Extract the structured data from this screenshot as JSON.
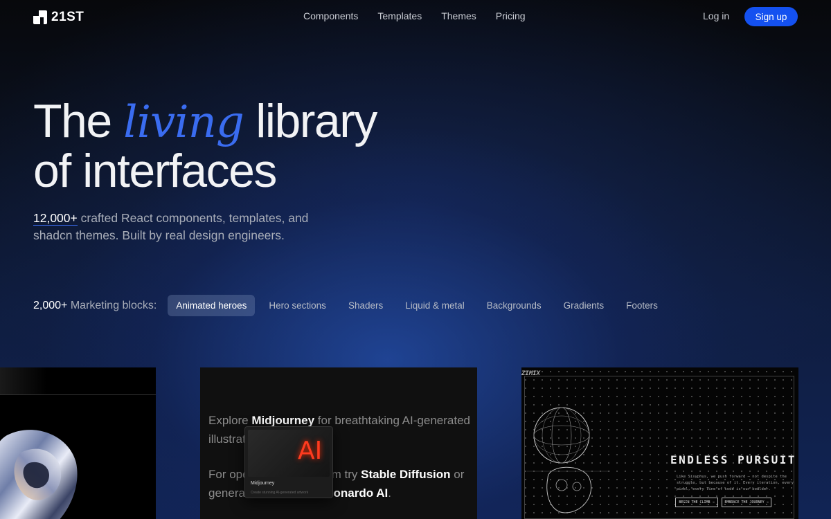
{
  "brand": {
    "name": "21ST"
  },
  "nav": {
    "links": [
      "Components",
      "Templates",
      "Themes",
      "Pricing"
    ],
    "login": "Log in",
    "signup": "Sign up"
  },
  "hero": {
    "title_part1": "The",
    "title_accent": "living",
    "title_part2": "library",
    "title_line2": "of interfaces",
    "subtitle_count": "12,000+",
    "subtitle_rest": " crafted React components, templates, and shadcn themes. Built by real design engineers.",
    "accent_color": "#3a6cf0"
  },
  "marketing": {
    "count": "2,000+",
    "label": " Marketing blocks:",
    "tags": [
      "Animated heroes",
      "Hero sections",
      "Shaders",
      "Liquid & metal",
      "Backgrounds",
      "Gradients",
      "Footers"
    ],
    "active_tag": "Animated heroes"
  },
  "cards": {
    "card2": {
      "p1_a": "Explore ",
      "p1_b": "Midjourney",
      "p1_c": " for breathtaking AI-generated illustrations.",
      "p2_a": "For open-source freedom try ",
      "p2_b": "Stable Diffusion",
      "p2_c": " or generate assets with ",
      "p2_d": "Leonardo AI",
      "p2_e": ".",
      "popup_title": "Midjourney",
      "popup_sub": "Create stunning AI-generated artwork",
      "popup_glyph": "AI"
    },
    "card3": {
      "label": "ZIMIX",
      "title": "ENDLESS PURSUIT",
      "body": "Like Sisyphus, we push forward — not despite the struggle, but because of it. Every iteration, every pixel, every line of code is our boulder.",
      "btn1": "BEGIN THE CLIMB →",
      "btn2": "EMBRACE THE JOURNEY →"
    }
  },
  "colors": {
    "signup_bg": "#1451f0",
    "bg_glow": "#1e46a8"
  }
}
